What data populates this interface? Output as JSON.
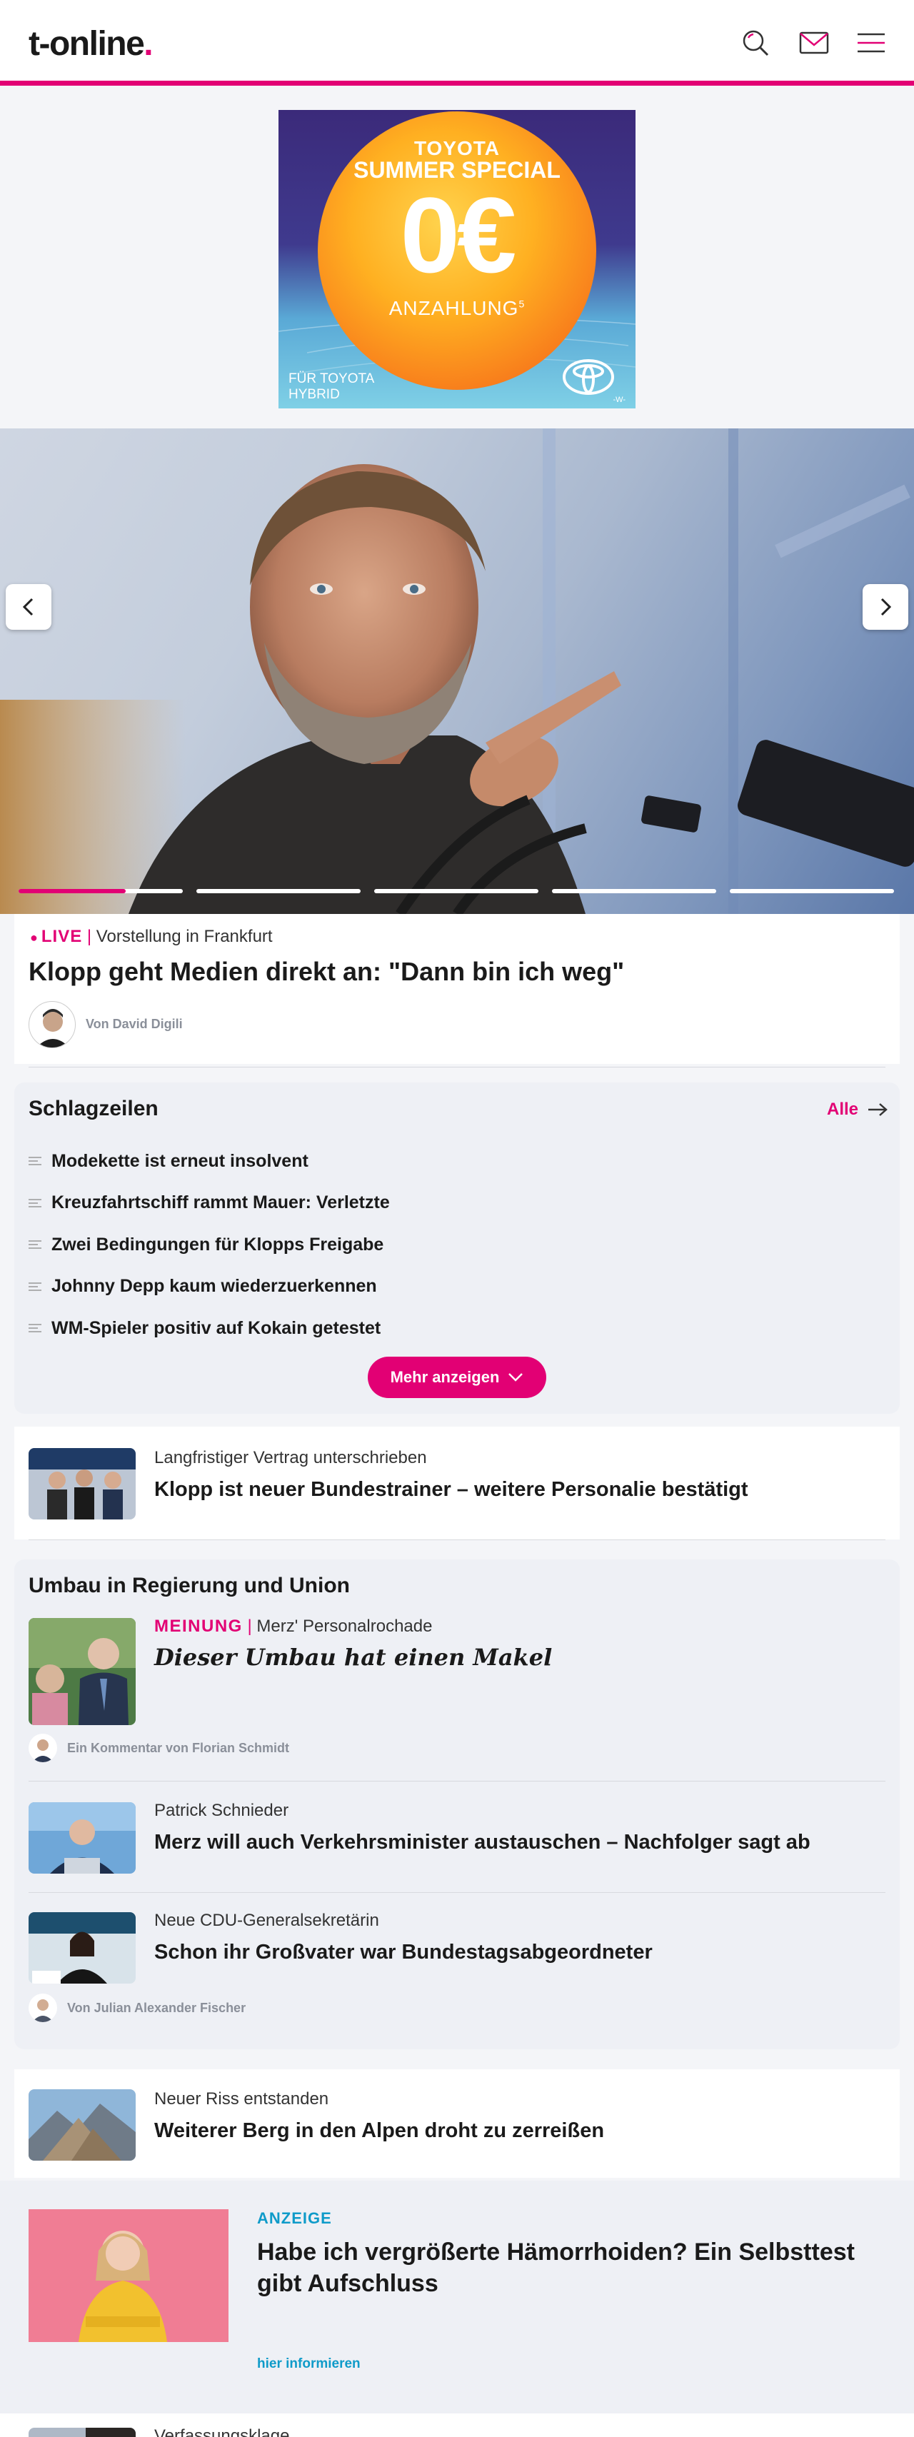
{
  "header": {
    "logo_text": "t-online",
    "logo_dot": ".",
    "icons": [
      "search-icon",
      "mail-icon",
      "menu-icon"
    ],
    "accent_color": "#e20074"
  },
  "ad_banner": {
    "brand": "TOYOTA",
    "headline": "SUMMER SPECIAL",
    "amount": "0€",
    "sub": "ANZAHLUNG",
    "sup": "5",
    "footer_line1": "FÜR TOYOTA",
    "footer_line2": "HYBRID",
    "corner_mark": "-W-"
  },
  "hero": {
    "slides_total": 5,
    "active_slide": 1,
    "progress_fraction": 0.65,
    "live_label": "LIVE",
    "separator": "|",
    "kicker": "Vorstellung in Frankfurt",
    "title": "Klopp geht Medien direkt an: \"Dann bin ich weg\"",
    "author": "Von David Digili"
  },
  "headlines": {
    "title": "Schlagzeilen",
    "all_link": "Alle",
    "items": [
      "Modekette ist erneut insolvent",
      "Kreuzfahrtschiff rammt Mauer: Verletzte",
      "Zwei Bedingungen für Klopps Freigabe",
      "Johnny Depp kaum wiederzuerkennen",
      "WM-Spieler positiv auf Kokain getestet"
    ],
    "more_button": "Mehr anzeigen"
  },
  "teaser_klopp": {
    "kicker": "Langfristiger Vertrag unterschrieben",
    "title": "Klopp ist neuer Bundestrainer – weitere Personalie bestätigt"
  },
  "section_umbau": {
    "title": "Umbau in Regierung und Union",
    "opinion": {
      "label": "MEINUNG",
      "separator": "|",
      "kicker": "Merz' Personalrochade",
      "title": "Dieser Umbau hat einen Makel",
      "author": "Ein Kommentar von Florian Schmidt"
    },
    "item2": {
      "kicker": "Patrick Schnieder",
      "title": "Merz will auch Verkehrsminister austauschen – Nachfolger sagt ab"
    },
    "item3": {
      "kicker": "Neue CDU-Generalsekretärin",
      "title": "Schon ihr Großvater war Bundestagsabgeordneter",
      "author": "Von Julian Alexander Fischer"
    }
  },
  "teaser_alps": {
    "kicker": "Neuer Riss entstanden",
    "title": "Weiterer Berg in den Alpen droht zu zerreißen"
  },
  "sponsored": {
    "label": "ANZEIGE",
    "title": "Habe ich vergrößerte Hämorrhoiden? Ein Selbsttest gibt Aufschluss",
    "link": "hier informieren"
  },
  "teaser_partial": {
    "kicker": "Verfassungsklage"
  }
}
